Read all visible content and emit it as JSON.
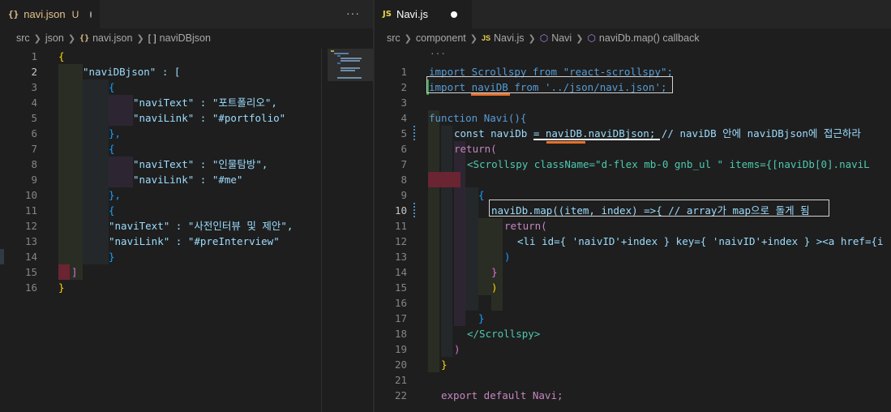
{
  "left": {
    "tab": {
      "icon": "json-braces-icon",
      "icon_text": "{}",
      "label": "navi.json",
      "status": "U"
    },
    "more_actions": "···",
    "breadcrumb": [
      "src",
      "json",
      "navi.json",
      "naviDBjson"
    ],
    "breadcrumb_icons": {
      "file": "{}",
      "symbol": "[ ]"
    },
    "line_numbers": [
      "1",
      "2",
      "3",
      "4",
      "5",
      "6",
      "7",
      "8",
      "9",
      "10",
      "11",
      "12",
      "13",
      "14",
      "15",
      "16"
    ],
    "active_line": "2",
    "code": [
      "{",
      "\"naviDBjson\" : [",
      "{",
      "\"naviText\" : \"포트폴리오\",",
      "\"naviLink\" : \"#portfolio\"",
      "},",
      "{",
      "\"naviText\" : \"인물탐방\",",
      "\"naviLink\" : \"#me\"",
      "},",
      "{",
      "\"naviText\" : \"사전인터뷰 및 제안\",",
      "\"naviLink\" : \"#preInterview\"",
      "}",
      "]",
      "}"
    ]
  },
  "right": {
    "tab": {
      "icon": "js-file-icon",
      "icon_text": "JS",
      "label": "Navi.js"
    },
    "breadcrumb": [
      "src",
      "component",
      "Navi.js",
      "Navi",
      "naviDb.map() callback"
    ],
    "breadcrumb_icons": {
      "file": "JS"
    },
    "fold_hint": "...",
    "line_numbers": [
      "1",
      "2",
      "3",
      "4",
      "5",
      "6",
      "7",
      "8",
      "9",
      "10",
      "11",
      "12",
      "13",
      "14",
      "15",
      "16",
      "17",
      "18",
      "19",
      "20",
      "21",
      "22"
    ],
    "active_line": "10",
    "code": [
      "import Scrollspy from \"react-scrollspy\";",
      "import naviDB from '../json/navi.json';",
      "",
      "function Navi(){",
      "const naviDb = naviDB.naviDBjson; // naviDB 안에 naviDBjson에 접근하라",
      "return(",
      "<Scrollspy className=\"d-flex mb-0 gnb_ul \" items={[naviDb[0].naviL",
      "",
      "{",
      "naviDb.map((item, index) =>{ // array가 map으로 돌게 됨",
      "return(",
      "<li id={ 'naivID'+index } key={ 'naivID'+index } ><a href={i",
      ")",
      "}",
      ")",
      "",
      "}",
      "</Scrollspy>",
      ")",
      "}",
      "",
      "export default Navi;"
    ],
    "colors": {
      "highlight_box": "#d4d4d4",
      "underline_orange": "#e8712b",
      "underline_white": "#ffffff",
      "modified_gutter": "#2ea043"
    }
  }
}
